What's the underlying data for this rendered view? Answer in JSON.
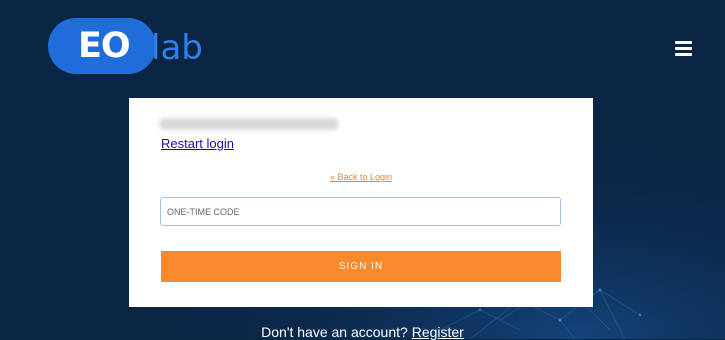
{
  "brand": {
    "logo_eo": "EO",
    "logo_lab": "lab",
    "primary_color": "#1f6dd8",
    "accent_color": "#f8892d",
    "background_color": "#0b2545"
  },
  "header": {
    "menu_icon": "hamburger-menu-icon"
  },
  "login": {
    "restart_label": "Restart login",
    "back_label": "« Back to Login",
    "otp_placeholder": "ONE-TIME CODE",
    "otp_value": "",
    "signin_label": "SIGN IN"
  },
  "footer": {
    "no_account_text": "Don't have an account?",
    "register_label": "Register"
  }
}
